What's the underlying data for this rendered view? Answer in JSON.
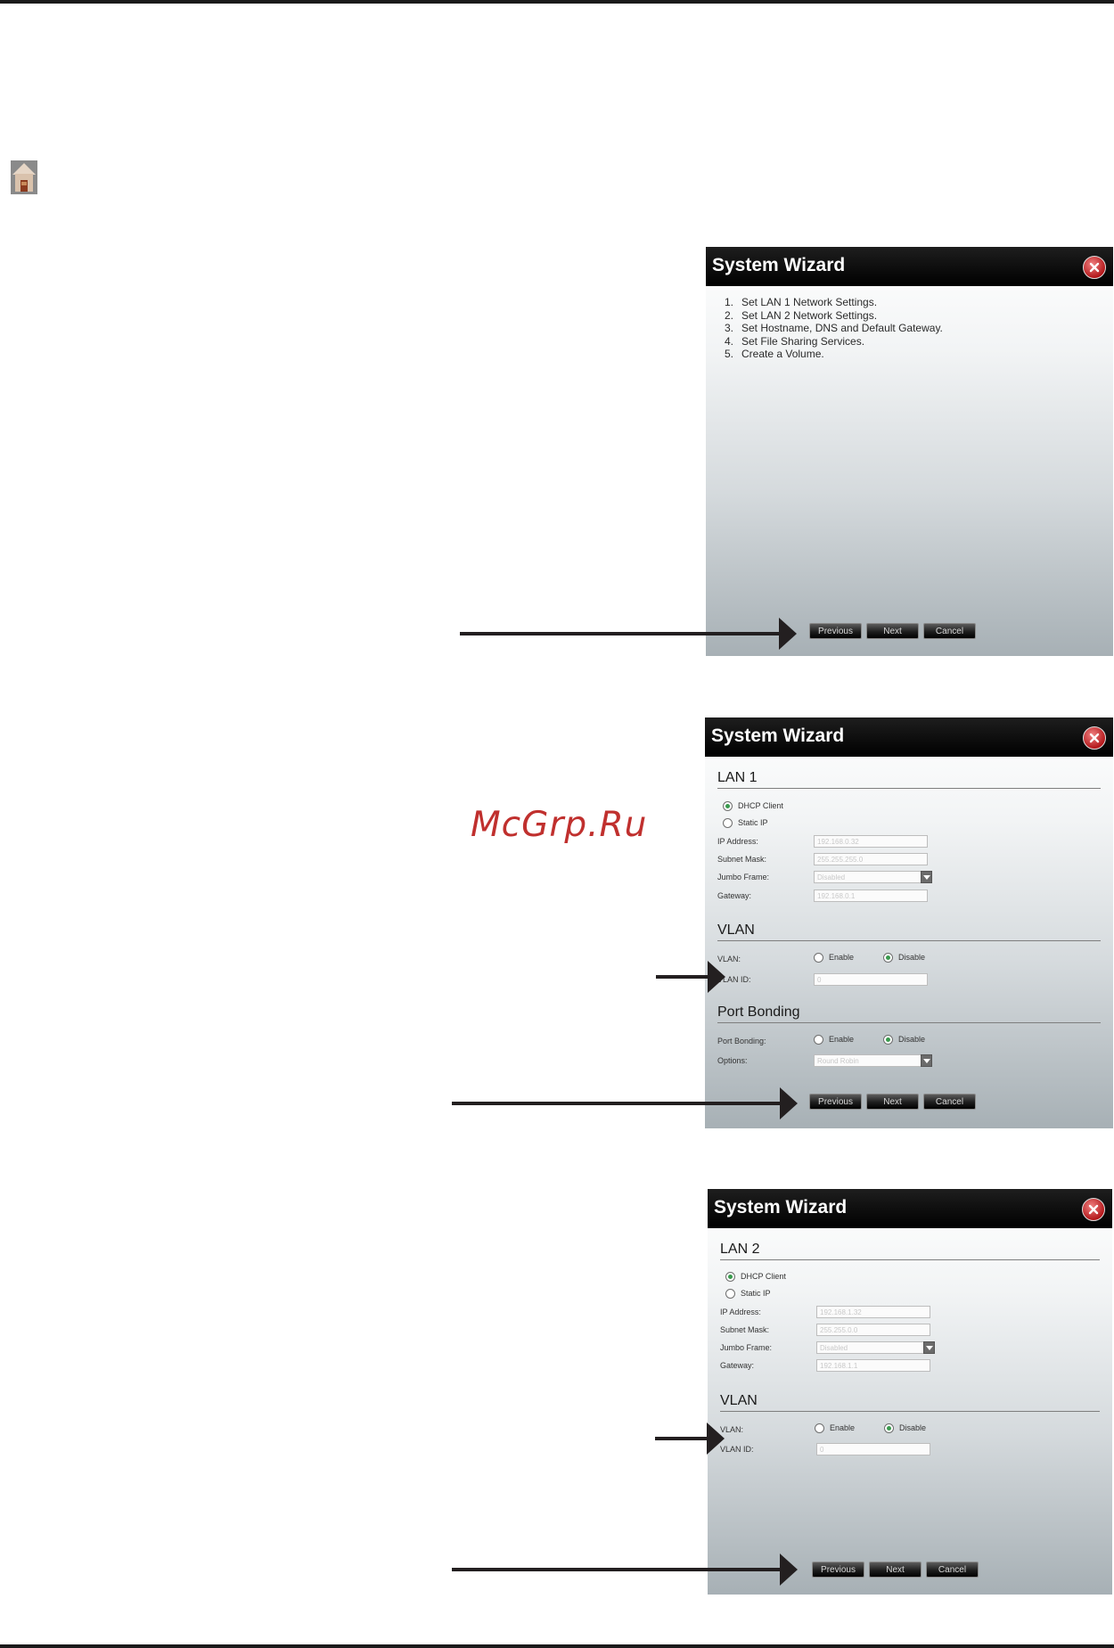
{
  "wizard1": {
    "title": "System Wizard",
    "steps": [
      {
        "num": "1.",
        "text": "Set LAN 1 Network Settings."
      },
      {
        "num": "2.",
        "text": "Set LAN 2 Network Settings."
      },
      {
        "num": "3.",
        "text": "Set Hostname, DNS and Default Gateway."
      },
      {
        "num": "4.",
        "text": "Set File Sharing Services."
      },
      {
        "num": "5.",
        "text": "Create a Volume."
      }
    ],
    "buttons": {
      "previous": "Previous",
      "next": "Next",
      "cancel": "Cancel"
    }
  },
  "wizard2": {
    "title": "System Wizard",
    "lan": {
      "heading": "LAN 1",
      "dhcp_label": "DHCP Client",
      "static_label": "Static IP",
      "ip_label": "IP Address:",
      "ip_value": "192.168.0.32",
      "mask_label": "Subnet Mask:",
      "mask_value": "255.255.255.0",
      "jumbo_label": "Jumbo Frame:",
      "jumbo_value": "Disabled",
      "gateway_label": "Gateway:",
      "gateway_value": "192.168.0.1",
      "selected_mode": "dhcp"
    },
    "vlan": {
      "heading": "VLAN",
      "vlan_label": "VLAN:",
      "enable": "Enable",
      "disable": "Disable",
      "id_label": "VLAN ID:",
      "id_value": "0",
      "selected": "disable"
    },
    "bonding": {
      "heading": "Port Bonding",
      "label": "Port Bonding:",
      "enable": "Enable",
      "disable": "Disable",
      "options_label": "Options:",
      "options_value": "Round Robin",
      "selected": "disable"
    },
    "buttons": {
      "previous": "Previous",
      "next": "Next",
      "cancel": "Cancel"
    }
  },
  "wizard3": {
    "title": "System Wizard",
    "lan": {
      "heading": "LAN 2",
      "dhcp_label": "DHCP Client",
      "static_label": "Static IP",
      "ip_label": "IP Address:",
      "ip_value": "192.168.1.32",
      "mask_label": "Subnet Mask:",
      "mask_value": "255.255.0.0",
      "jumbo_label": "Jumbo Frame:",
      "jumbo_value": "Disabled",
      "gateway_label": "Gateway:",
      "gateway_value": "192.168.1.1",
      "selected_mode": "dhcp"
    },
    "vlan": {
      "heading": "VLAN",
      "vlan_label": "VLAN:",
      "enable": "Enable",
      "disable": "Disable",
      "id_label": "VLAN ID:",
      "id_value": "0",
      "selected": "disable"
    },
    "buttons": {
      "previous": "Previous",
      "next": "Next",
      "cancel": "Cancel"
    }
  },
  "watermark": "McGrp.Ru",
  "icons": {
    "home": "home-icon",
    "close": "close-icon",
    "arrow": "arrow-icon"
  },
  "colors": {
    "title_bar": "#000000",
    "close_button": "#c0282b",
    "radio_selected": "#3a9a4e",
    "watermark": "#c0302e"
  }
}
